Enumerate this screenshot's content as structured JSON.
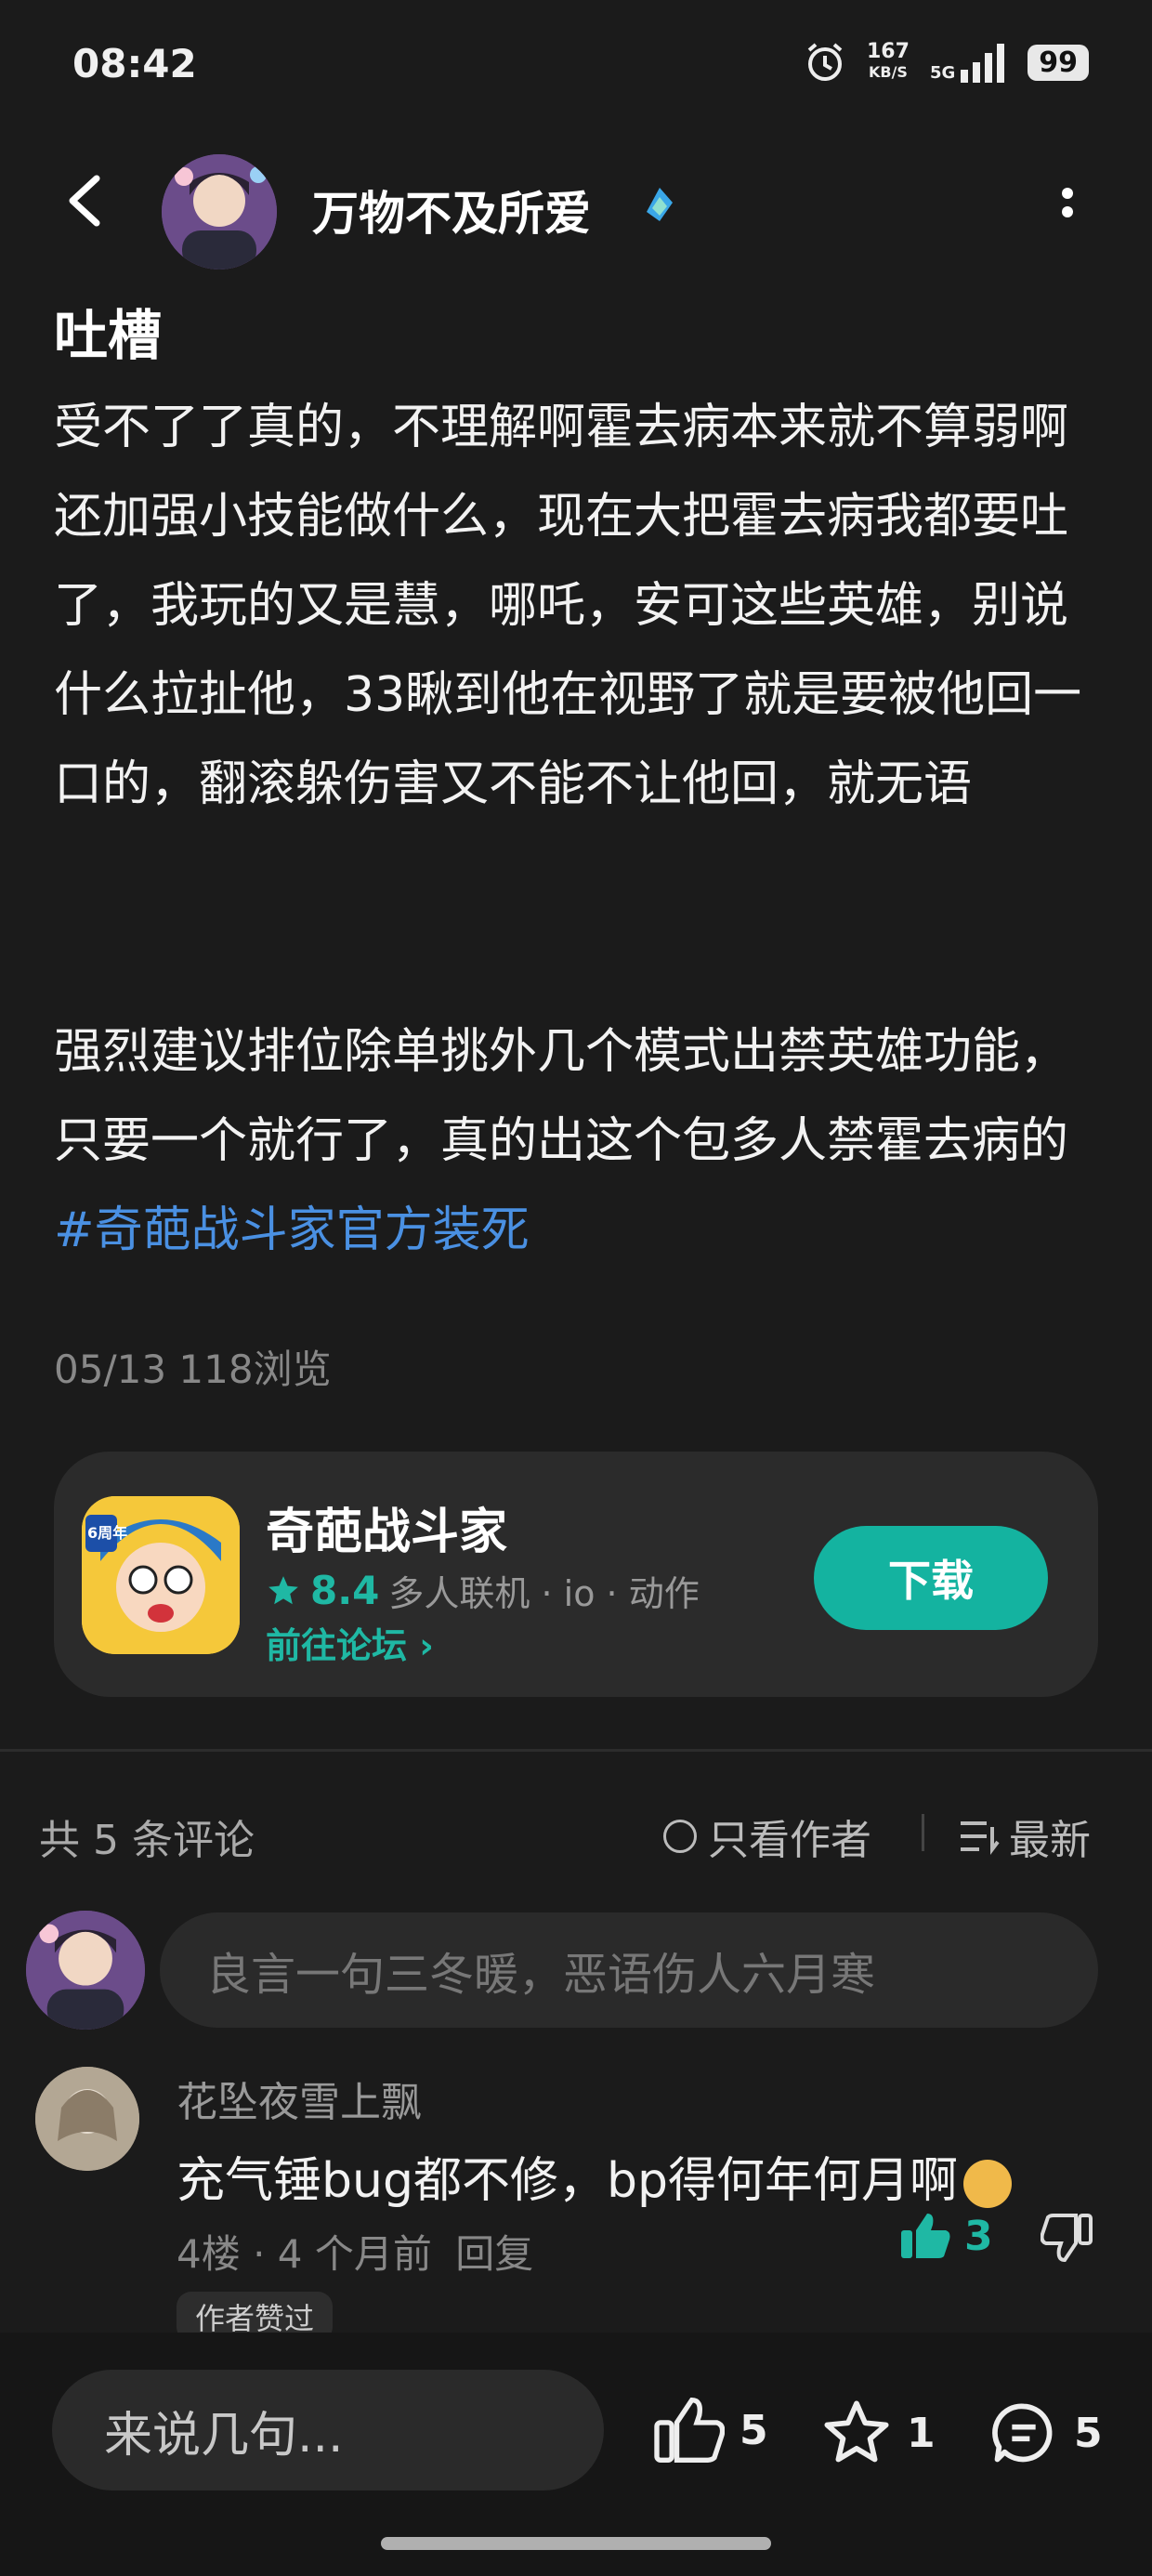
{
  "status_bar": {
    "time": "08:42",
    "speed_value": "167",
    "speed_unit": "KB/S",
    "network": "5G",
    "battery": "99"
  },
  "header": {
    "username": "万物不及所爱"
  },
  "post": {
    "title": "吐槽",
    "paragraph1": "受不了了真的，不理解啊霍去病本来就不算弱啊还加强小技能做什么，现在大把霍去病我都要吐了，我玩的又是慧，哪吒，安可这些英雄，别说什么拉扯他，33瞅到他在视野了就是要被他回一口的，翻滚躲伤害又不能不让他回，就无语",
    "paragraph2": "强烈建议排位除单挑外几个模式出禁英雄功能，只要一个就行了，真的出这个包多人禁霍去病的",
    "hashtag": "#奇葩战斗家官方装死",
    "date": "05/13",
    "views": "118浏览"
  },
  "app_card": {
    "name": "奇葩战斗家",
    "rating": "8.4",
    "tags": "多人联机 · io · 动作",
    "forum_link": "前往论坛",
    "download_label": "下载",
    "icon_badge": "6周年"
  },
  "comments": {
    "count_label": "共 5 条评论",
    "only_author_label": "只看作者",
    "sort_label": "最新",
    "input_placeholder": "良言一句三冬暖，恶语伤人六月寒",
    "items": [
      {
        "author": "花坠夜雪上飘",
        "text": "充气锤bug都不修，bp得何年何月啊",
        "meta": "4楼 · 4 个月前",
        "reply_label": "回复",
        "likes": "3",
        "badge": "作者赞过"
      }
    ]
  },
  "bottom_bar": {
    "input_placeholder": "来说几句...",
    "likes": "5",
    "favorites": "1",
    "comments": "5"
  },
  "colors": {
    "background": "#1b1b1b",
    "accent": "#14b3a0",
    "link": "#4a90e2"
  }
}
